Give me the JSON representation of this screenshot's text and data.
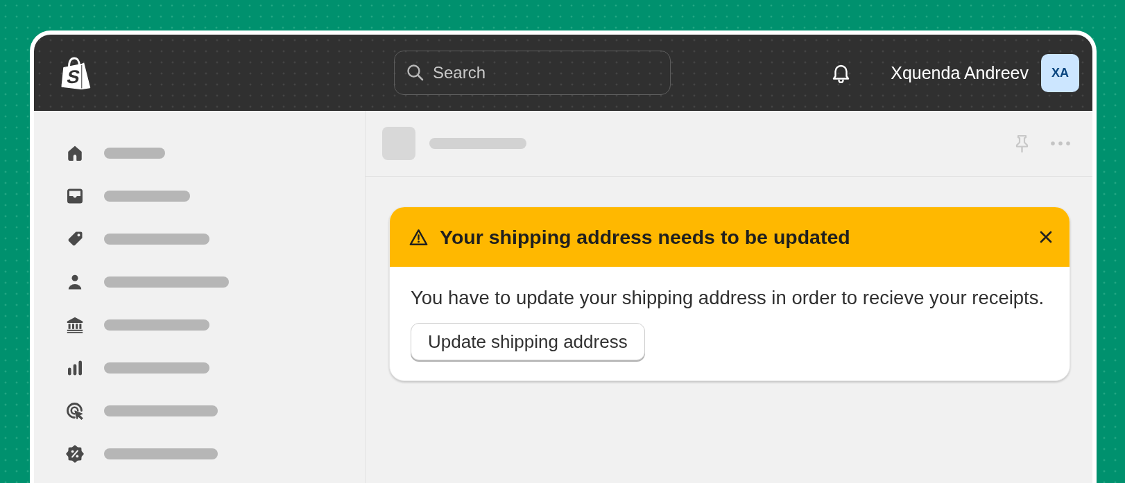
{
  "top_bar": {
    "logo": {
      "letter": "S"
    },
    "search": {
      "placeholder": "Search"
    },
    "user": {
      "name": "Xquenda Andreev",
      "initials": "XA"
    }
  },
  "banner": {
    "title": "Your shipping address needs to be updated",
    "message": "You have to update your shipping address in order to recieve your receipts.",
    "button": "Update shipping address"
  }
}
